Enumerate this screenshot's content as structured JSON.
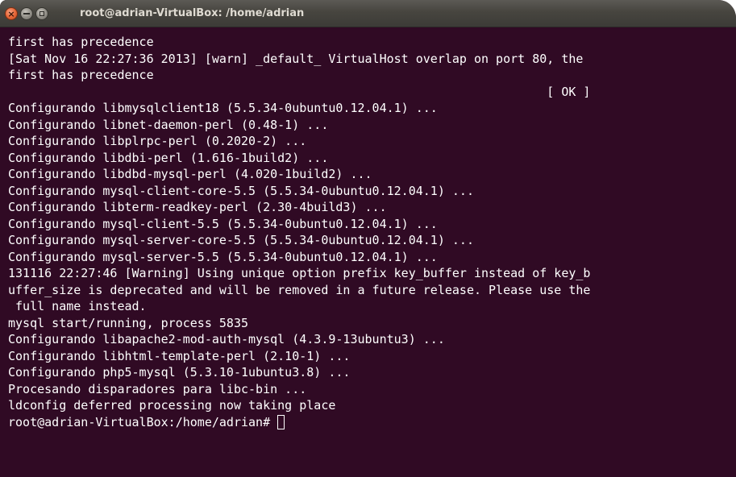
{
  "window": {
    "title": "root@adrian-VirtualBox: /home/adrian"
  },
  "terminal": {
    "lines": [
      "first has precedence",
      "[Sat Nov 16 22:27:36 2013] [warn] _default_ VirtualHost overlap on port 80, the",
      "first has precedence",
      "                                                                          [ OK ]",
      "Configurando libmysqlclient18 (5.5.34-0ubuntu0.12.04.1) ...",
      "Configurando libnet-daemon-perl (0.48-1) ...",
      "Configurando libplrpc-perl (0.2020-2) ...",
      "Configurando libdbi-perl (1.616-1build2) ...",
      "Configurando libdbd-mysql-perl (4.020-1build2) ...",
      "Configurando mysql-client-core-5.5 (5.5.34-0ubuntu0.12.04.1) ...",
      "Configurando libterm-readkey-perl (2.30-4build3) ...",
      "Configurando mysql-client-5.5 (5.5.34-0ubuntu0.12.04.1) ...",
      "Configurando mysql-server-core-5.5 (5.5.34-0ubuntu0.12.04.1) ...",
      "Configurando mysql-server-5.5 (5.5.34-0ubuntu0.12.04.1) ...",
      "131116 22:27:46 [Warning] Using unique option prefix key_buffer instead of key_b",
      "uffer_size is deprecated and will be removed in a future release. Please use the",
      " full name instead.",
      "mysql start/running, process 5835",
      "Configurando libapache2-mod-auth-mysql (4.3.9-13ubuntu3) ...",
      "Configurando libhtml-template-perl (2.10-1) ...",
      "Configurando php5-mysql (5.3.10-1ubuntu3.8) ...",
      "Procesando disparadores para libc-bin ...",
      "ldconfig deferred processing now taking place"
    ],
    "prompt": "root@adrian-VirtualBox:/home/adrian# "
  }
}
